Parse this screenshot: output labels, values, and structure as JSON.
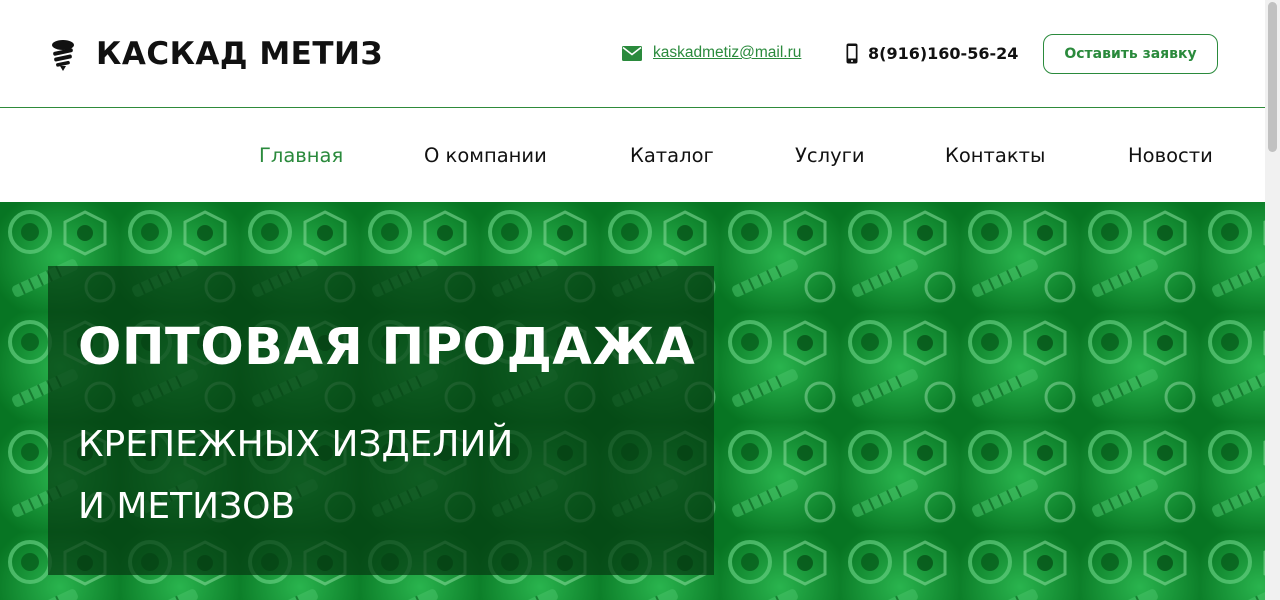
{
  "header": {
    "logo_text": "КАСКАД МЕТИЗ",
    "logo_icon": "screw-icon",
    "email": "kaskadmetiz@mail.ru",
    "email_icon": "envelope-icon",
    "phone": "8(916)160-56-24",
    "phone_icon": "mobile-phone-icon",
    "request_button": "Оставить заявку"
  },
  "nav": {
    "items": [
      {
        "label": "Главная",
        "active": true
      },
      {
        "label": "О компании",
        "active": false
      },
      {
        "label": "Каталог",
        "active": false
      },
      {
        "label": "Услуги",
        "active": false
      },
      {
        "label": "Контакты",
        "active": false
      },
      {
        "label": "Новости",
        "active": false
      }
    ]
  },
  "hero": {
    "title": "ОПТОВАЯ ПРОДАЖА",
    "subtitle_line1": "КРЕПЕЖНЫХ ИЗДЕЛИЙ",
    "subtitle_line2": "И МЕТИЗОВ"
  },
  "colors": {
    "accent": "#2a8a3c",
    "hero_green": "#0c8a2b",
    "panel_overlay": "#063c12"
  }
}
